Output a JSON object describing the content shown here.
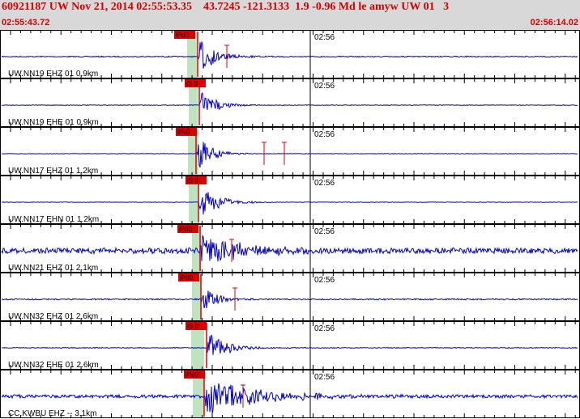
{
  "header": {
    "title": "60921187 UW Nov 21, 2014 02:55:53.35    43.7245 -121.3133  1.9 -0.96 Md le amyw UW 01   3",
    "start_time": "02:55:43.72",
    "end_time": "02:56:14.02"
  },
  "colors": {
    "trace": "#0000d0",
    "pick": "#dd0000",
    "window": "#bfe3bf",
    "header_bg": "#d8d8d8",
    "header_text": "#d40000"
  },
  "traces": [
    {
      "station": "UW.NN19 EHZ 01 0.9km",
      "pick_label": "iPd0",
      "time_label": "02:56"
    },
    {
      "station": "UW.NN19 EHE 01 0.9km",
      "pick_label": "iS 0",
      "time_label": "02:56"
    },
    {
      "station": "UW.NN17 EHZ 01 1.2km",
      "pick_label": "iPc0",
      "time_label": "02:56"
    },
    {
      "station": "UW.NN17 EHN 01 1.2km",
      "pick_label": "iS 0",
      "time_label": "02:56"
    },
    {
      "station": "UW.NN21 EHZ 01 2.1km",
      "pick_label": "iPd0",
      "time_label": "02:56"
    },
    {
      "station": "UW.NN32 EHZ 01 2.6km",
      "pick_label": "iPd0",
      "time_label": "02:56"
    },
    {
      "station": "UW.NN32 EHE 01 2.6km",
      "pick_label": "iS 0",
      "time_label": "02:56"
    },
    {
      "station": "CC.KWBU EHZ -- 3.1km",
      "pick_label": "iPd0",
      "time_label": "02:56"
    }
  ]
}
